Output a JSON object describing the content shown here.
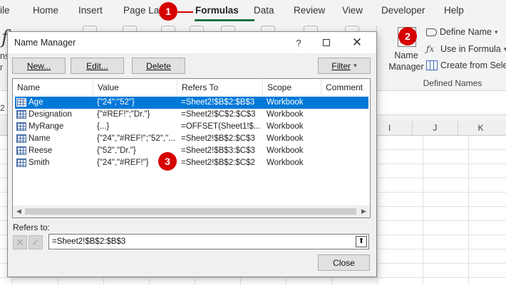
{
  "ribbon": {
    "tabs": [
      "ile",
      "Home",
      "Insert",
      "Page Lay",
      "Formulas",
      "Data",
      "Review",
      "View",
      "Developer",
      "Help"
    ],
    "active_tab": "Formulas",
    "accent_color": "#1e7145",
    "name_manager_label": "Name Manager",
    "define_name_label": "Define Name",
    "use_in_formula_label": "Use in Formula",
    "create_from_selection_label": "Create from Selec",
    "group_label": "Defined Names",
    "left_stub_1": "f",
    "left_stub_2": "ns",
    "left_stub_3": "r"
  },
  "sheet": {
    "columns": [
      "I",
      "J",
      "K"
    ],
    "row_stub": "2"
  },
  "dialog": {
    "title": "Name Manager",
    "help_glyph": "?",
    "close_glyph": "✕",
    "buttons": {
      "new": "New...",
      "edit": "Edit...",
      "delete": "Delete",
      "filter": "Filter",
      "close": "Close"
    },
    "columns": [
      "Name",
      "Value",
      "Refers To",
      "Scope",
      "Comment"
    ],
    "rows": [
      {
        "name": "Age",
        "value": "{\"24\";\"52\"}",
        "refers_to": "=Sheet2!$B$2:$B$3",
        "scope": "Workbook",
        "comment": ""
      },
      {
        "name": "Designation",
        "value": "{\"#REF!\";\"Dr.\"}",
        "refers_to": "=Sheet2!$C$2:$C$3",
        "scope": "Workbook",
        "comment": ""
      },
      {
        "name": "MyRange",
        "value": "{...}",
        "refers_to": "=OFFSET(Sheet1!$...",
        "scope": "Workbook",
        "comment": ""
      },
      {
        "name": "Name",
        "value": "{\"24\",\"#REF!\";\"52\",\"...",
        "refers_to": "=Sheet2!$B$2:$C$3",
        "scope": "Workbook",
        "comment": ""
      },
      {
        "name": "Reese",
        "value": "{\"52\",\"Dr.\"}",
        "refers_to": "=Sheet2!$B$3:$C$3",
        "scope": "Workbook",
        "comment": ""
      },
      {
        "name": "Smith",
        "value": "{\"24\",\"#REF!\"}",
        "refers_to": "=Sheet2!$B$2:$C$2",
        "scope": "Workbook",
        "comment": ""
      }
    ],
    "selected_row": 0,
    "selection_color": "#0078d7",
    "refers_to_label": "Refers to:",
    "refers_to_value": "=Sheet2!$B$2:$B$3"
  },
  "callouts": [
    "1",
    "2",
    "3"
  ],
  "callout_color": "#d60000"
}
